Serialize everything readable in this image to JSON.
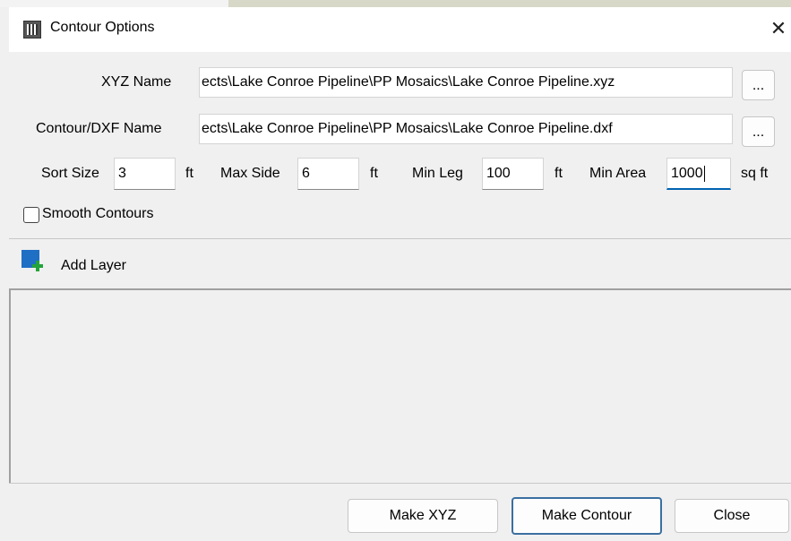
{
  "window": {
    "title": "Contour Options",
    "close_glyph": "✕"
  },
  "form": {
    "xyz_label": "XYZ Name",
    "xyz_value": "C:\\Projects\\Lake Conroe Pipeline\\PP Mosaics\\Lake Conroe Pipeline.xyz",
    "xyz_visible": "ects\\Lake Conroe Pipeline\\PP Mosaics\\Lake Conroe Pipeline.xyz",
    "dxf_label": "Contour/DXF Name",
    "dxf_visible": "ects\\Lake Conroe Pipeline\\PP Mosaics\\Lake Conroe Pipeline.dxf",
    "browse_label": "...",
    "sort_size_label": "Sort Size",
    "sort_size_value": "3",
    "max_side_label": "Max Side",
    "max_side_value": "6",
    "min_leg_label": "Min Leg",
    "min_leg_value": "100",
    "min_area_label": "Min Area",
    "min_area_value": "1000",
    "unit_ft": "ft",
    "unit_sqft": "sq ft",
    "smooth_label": "Smooth Contours",
    "smooth_checked": false
  },
  "layers": {
    "add_label": "Add Layer"
  },
  "buttons": {
    "make_xyz": "Make XYZ",
    "make_contour": "Make Contour",
    "close": "Close"
  },
  "icons": {
    "app": "contour-app-icon",
    "add_layer": "add-layer-icon",
    "close": "close-icon"
  },
  "colors": {
    "focus_accent": "#0063b1",
    "add_layer_blue": "#1f6fc5",
    "add_layer_green": "#23a33a"
  }
}
